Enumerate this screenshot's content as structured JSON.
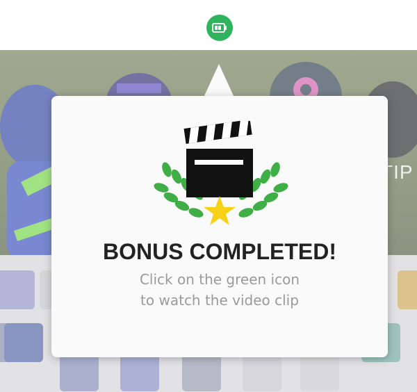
{
  "header": {
    "icon": "battery-video-icon",
    "accent": "#2fb45d"
  },
  "background": {
    "hint_text": "TIP"
  },
  "dialog": {
    "title": "BONUS COMPLETED!",
    "message_line1": "Click on the green icon",
    "message_line2": "to watch the video clip",
    "icon": "clapperboard-laurel-star-icon",
    "laurel_color": "#3fae46",
    "star_color": "#f7d117"
  }
}
